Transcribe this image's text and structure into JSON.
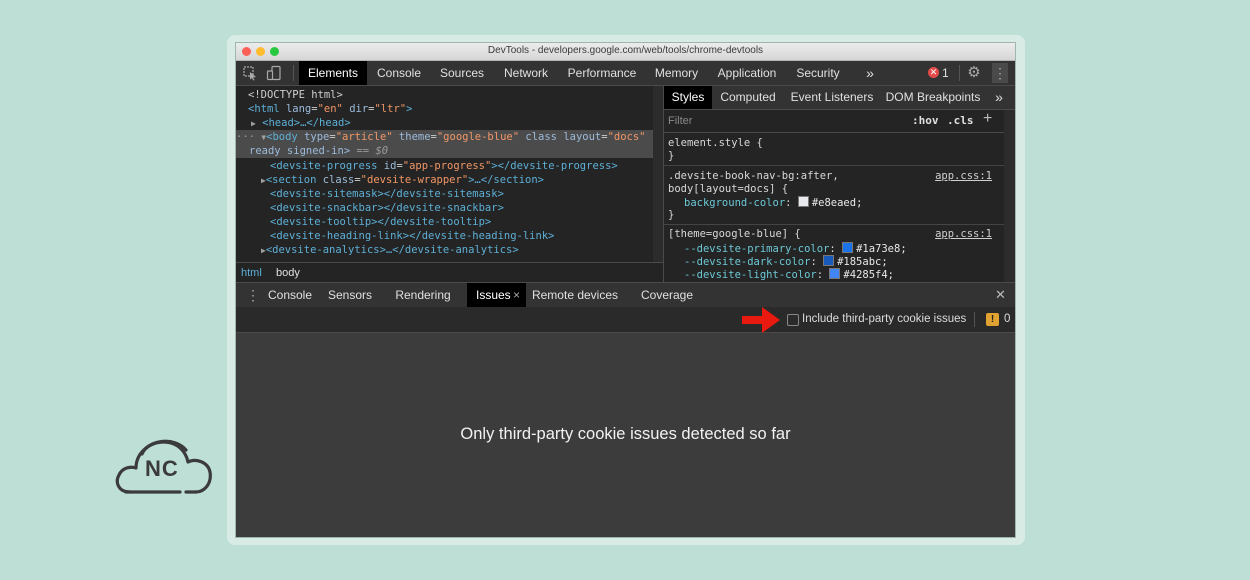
{
  "window": {
    "title": "DevTools - developers.google.com/web/tools/chrome-devtools"
  },
  "toolbar": {
    "tabs": [
      "Elements",
      "Console",
      "Sources",
      "Network",
      "Performance",
      "Memory",
      "Application",
      "Security"
    ],
    "more": "»",
    "error_count": "1"
  },
  "dom": {
    "doctype": "<!DOCTYPE html>",
    "html_open": "<html",
    "html_lang_attr": "lang",
    "html_lang_val": "\"en\"",
    "html_dir_attr": "dir",
    "html_dir_val": "\"ltr\"",
    "head": "<head>…</head>",
    "body_open": "<body",
    "body_type_attr": "type",
    "body_type_val": "\"article\"",
    "body_theme_attr": "theme",
    "body_theme_val": "\"google-blue\"",
    "body_class_attr": "class",
    "body_layout_attr": "layout",
    "body_layout_val": "\"docs\"",
    "body_line2": "ready signed-in>",
    "body_eq": "== $0",
    "progress_open": "<devsite-progress",
    "progress_id_attr": "id",
    "progress_id_val": "\"app-progress\"",
    "progress_close": "></devsite-progress>",
    "section_open": "<section",
    "section_class_attr": "class",
    "section_class_val": "\"devsite-wrapper\"",
    "section_close": ">…</section>",
    "sitemask": "<devsite-sitemask></devsite-sitemask>",
    "snackbar": "<devsite-snackbar></devsite-snackbar>",
    "tooltip": "<devsite-tooltip></devsite-tooltip>",
    "heading_link": "<devsite-heading-link></devsite-heading-link>",
    "analytics": "<devsite-analytics>…</devsite-analytics>"
  },
  "breadcrumbs": [
    "html",
    "body"
  ],
  "styles": {
    "tabs": [
      "Styles",
      "Computed",
      "Event Listeners",
      "DOM Breakpoints"
    ],
    "more": "»",
    "filter_placeholder": "Filter",
    "hov": ":hov",
    "cls": ".cls",
    "plus": "+",
    "rule1_selector": "element.style {",
    "rule1_close": "}",
    "rule2_selector_a": ".devsite-book-nav-bg:after,",
    "rule2_selector_b": "body[layout=docs] {",
    "rule2_source": "app.css:1",
    "rule2_prop": "background-color",
    "rule2_value": "#e8eaed;",
    "rule2_close": "}",
    "rule3_selector": "[theme=google-blue] {",
    "rule3_source": "app.css:1",
    "rule3_props": [
      {
        "name": "--devsite-primary-color",
        "value": "#1a73e8;",
        "swatch": "#1a73e8"
      },
      {
        "name": "--devsite-dark-color",
        "value": "#185abc;",
        "swatch": "#185abc"
      },
      {
        "name": "--devsite-light-color",
        "value": "#4285f4;",
        "swatch": "#4285f4"
      }
    ],
    "swatch_bg": "#e8eaed"
  },
  "drawer": {
    "tabs": [
      "Console",
      "Sensors",
      "Rendering",
      "Issues",
      "Remote devices",
      "Coverage"
    ],
    "active_tab_close": "×",
    "close": "✕"
  },
  "issues": {
    "checkbox_label": "Include third-party cookie issues",
    "warning_count": "0",
    "message": "Only third-party cookie issues detected so far"
  },
  "logo": {
    "text": "NC"
  },
  "colors": {
    "arrow": "#e8190e",
    "traffic_red": "#fe5f57",
    "traffic_yellow": "#febc2e",
    "traffic_green": "#28c840"
  }
}
